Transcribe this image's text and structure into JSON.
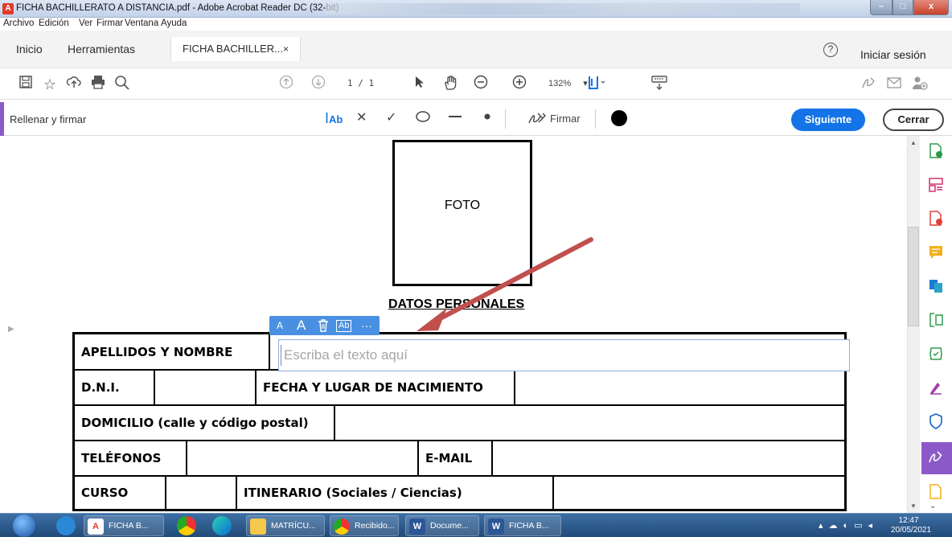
{
  "window": {
    "title": "FICHA BACHILLERATO A DISTANCIA.pdf - Adobe Acrobat Reader DC (32-bit)",
    "minimize": "–",
    "maximize": "□",
    "close": "x"
  },
  "menu": [
    "Archivo",
    "Edición",
    "Ver",
    "Firmar",
    "Ventana",
    "Ayuda"
  ],
  "tabs": {
    "home": "Inicio",
    "tools": "Herramientas",
    "document": "FICHA BACHILLER...",
    "close_glyph": "×"
  },
  "account": {
    "help_glyph": "?",
    "signin": "Iniciar sesión"
  },
  "toolbar": {
    "page_current": "1",
    "page_total": "/ 1",
    "zoom": "132%"
  },
  "fillsign": {
    "title": "Rellenar y firmar",
    "text_tool": "Ab",
    "sign_label": "Firmar",
    "next": "Siguiente",
    "close": "Cerrar"
  },
  "document": {
    "photo_label": "FOTO",
    "section_heading": "DATOS PERSONALES",
    "rows": [
      [
        "APELLIDOS Y NOMBRE"
      ],
      [
        "D.N.I.",
        "FECHA Y LUGAR DE NACIMIENTO"
      ],
      [
        "DOMICILIO (calle y código postal)"
      ],
      [
        "TELÉFONOS",
        "E-MAIL"
      ],
      [
        "CURSO",
        "ITINERARIO (Sociales / Ciencias)"
      ]
    ]
  },
  "text_field": {
    "placeholder": "Escriba el texto aquí",
    "tools": [
      "A",
      "A",
      "🗑",
      "Ab",
      "···"
    ]
  },
  "taskbar": {
    "items": [
      "FICHA B...",
      "MATRÍCU...",
      "Recibido...",
      "Docume...",
      "FICHA B..."
    ],
    "time": "12:47",
    "date": "20/05/2021"
  },
  "colors": {
    "accent_purple": "#8b5ac8",
    "primary_blue": "#1473e6",
    "annotation_arrow": "#c0504d"
  }
}
